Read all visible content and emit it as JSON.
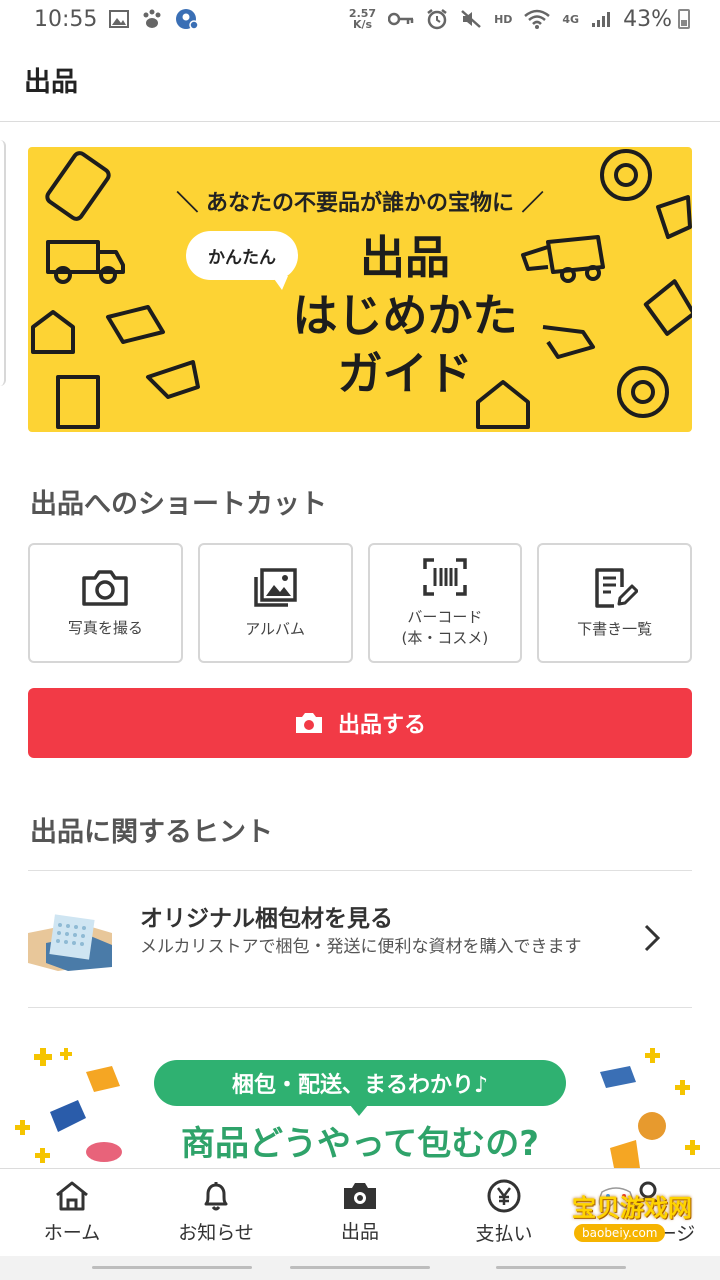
{
  "status_bar": {
    "time": "10:55",
    "net_speed_value": "2.57",
    "net_speed_unit": "K/s",
    "hd_label": "HD",
    "signal_label": "4G",
    "battery": "43%",
    "left_icons": [
      "image-icon",
      "paw-icon",
      "location-badge-icon"
    ],
    "right_icons": [
      "key-icon",
      "alarm-icon",
      "mute-icon",
      "wifi-icon",
      "cell-signal-icon",
      "battery-icon"
    ]
  },
  "header": {
    "title": "出品"
  },
  "banner": {
    "tagline": "＼ あなたの不要品が誰かの宝物に ／",
    "bubble": "かんたん",
    "title_line1": "出品",
    "title_line2": "はじめかた",
    "title_line3": "ガイド",
    "background_color": "#fdd334"
  },
  "shortcuts_section": {
    "title": "出品へのショートカット",
    "items": [
      {
        "label": "写真を撮る",
        "icon": "camera-icon"
      },
      {
        "label": "アルバム",
        "icon": "album-icon"
      },
      {
        "label": "バーコード\n(本・コスメ)",
        "icon": "barcode-icon"
      },
      {
        "label": "下書き一覧",
        "icon": "draft-list-icon"
      }
    ]
  },
  "sell_button": {
    "label": "出品する",
    "icon": "camera-icon",
    "color": "#f23a46"
  },
  "hints_section": {
    "title": "出品に関するヒント",
    "item": {
      "title": "オリジナル梱包材を見る",
      "description": "メルカリストアで梱包・発送に便利な資材を購入できます"
    }
  },
  "banner2": {
    "pill": "梱包・配送、まるわかり♪",
    "title": "商品どうやって包むの?",
    "accent_color": "#2fb171"
  },
  "bottom_nav": {
    "items": [
      {
        "label": "ホーム",
        "icon": "home-icon"
      },
      {
        "label": "お知らせ",
        "icon": "bell-icon"
      },
      {
        "label": "出品",
        "icon": "camera-icon"
      },
      {
        "label": "支払い",
        "icon": "yen-icon"
      },
      {
        "label": "マイページ",
        "icon": "person-icon"
      }
    ]
  },
  "watermark": {
    "text": "宝贝游戏网",
    "url": "baobeiy.com"
  }
}
